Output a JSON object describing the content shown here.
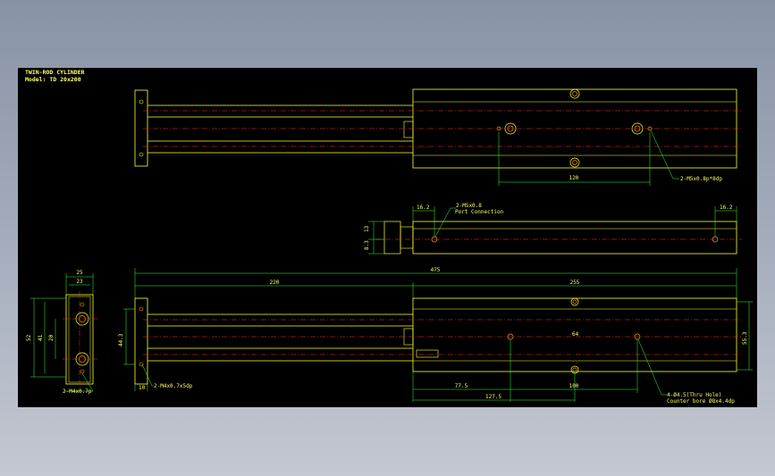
{
  "drawing": {
    "title": "TWIN-ROD CYLINDER",
    "model": "Model: TD 20x200"
  },
  "dimensions": {
    "top_spacing": "120",
    "top_note": "2-M5x0.8p*8dp",
    "mid_left": "16.2",
    "mid_right": "16.2",
    "mid_port": "2-M5x0.8",
    "mid_port_sub": "Port Connection",
    "mid_h1": "13",
    "mid_h2": "8.3",
    "overall": "475",
    "stroke": "220",
    "body_len": "255",
    "side_w_outer": "25",
    "side_w_inner": "23",
    "side_h_outer": "52",
    "side_h_mid": "41",
    "side_h_inner": "20",
    "side_note": "2-M4x0.7p",
    "end_h": "44.3",
    "end_note": "2-M4x0.7x5dp",
    "end_w": "10",
    "center_mark": "64",
    "right_h": "55.3",
    "bot_a": "77.5",
    "bot_b": "100",
    "bot_c": "127.5",
    "bot_note": "4-Ø4.5(Thru Hole)",
    "bot_note_sub": "Counter bore Ø8x4.4dp"
  },
  "colors": {
    "outline": "#ffff33",
    "dimension": "#33ff33",
    "center": "#ff3333",
    "hole": "#ff9900",
    "text": "#ffff66"
  }
}
